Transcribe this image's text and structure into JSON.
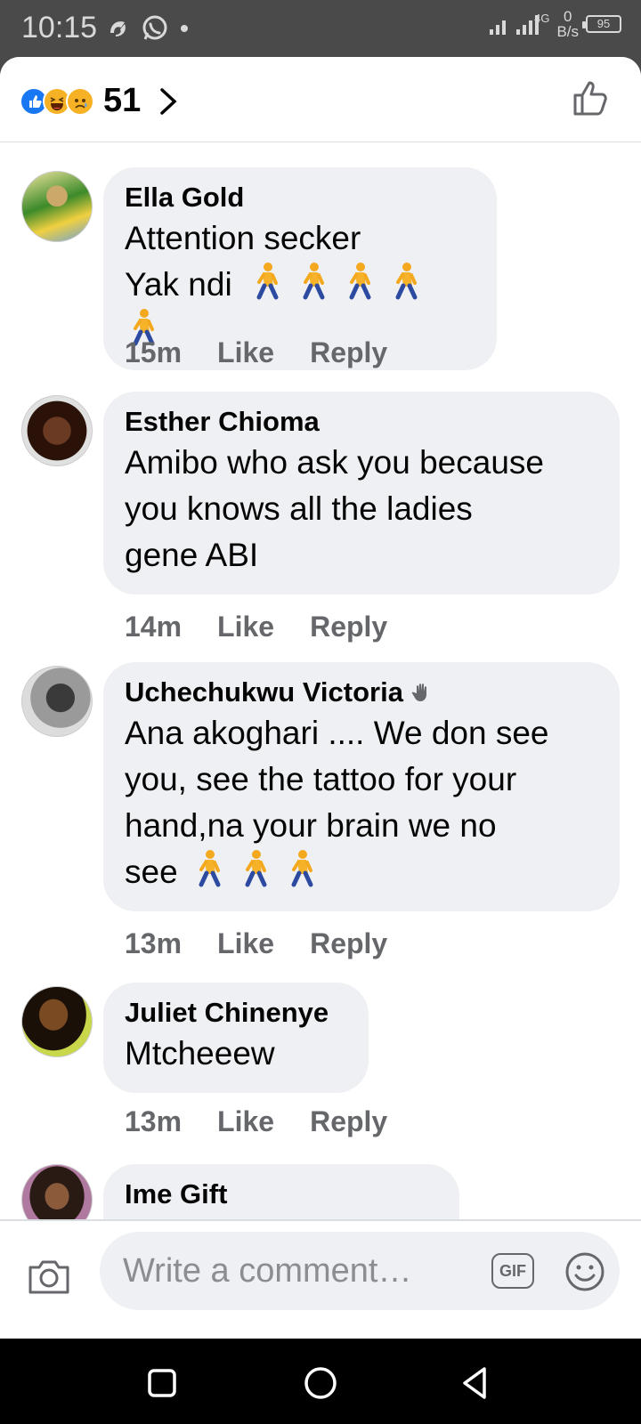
{
  "status_bar": {
    "time": "10:15",
    "network": "4G",
    "net_speed_value": "0",
    "net_speed_unit": "B/s",
    "battery": "95"
  },
  "header": {
    "reaction_count": "51",
    "reactions": [
      "like-icon",
      "haha-icon",
      "sad-icon"
    ]
  },
  "comments": [
    {
      "author": "Ella Gold",
      "lines": [
        "Attention secker",
        "Yak ndi"
      ],
      "walk_emoji_count": 5,
      "time": "15m"
    },
    {
      "author": "Esther Chioma",
      "lines": [
        "Amibo who ask you because",
        "you knows all the ladies",
        "gene ABI"
      ],
      "walk_emoji_count": 0,
      "time": "14m"
    },
    {
      "author": "Uchechukwu Victoria",
      "lines": [
        "Ana akoghari .... We don see",
        "you, see the tattoo for your",
        "hand,na your brain we no",
        "see"
      ],
      "walk_emoji_count": 3,
      "time": "13m"
    },
    {
      "author": "Juliet Chinenye",
      "lines": [
        "Mtcheeew"
      ],
      "walk_emoji_count": 0,
      "time": "13m"
    },
    {
      "author": "Ime Gift",
      "lines": [],
      "walk_emoji_count": 0,
      "time": ""
    }
  ],
  "actions": {
    "like": "Like",
    "reply": "Reply"
  },
  "composer": {
    "placeholder": "Write a comment…",
    "gif_label": "GIF"
  },
  "colors": {
    "bubble": "#eff0f3",
    "meta_text": "#65676b",
    "like_blue": "#1877f2",
    "status_bar_bg": "#4a4a4a"
  }
}
